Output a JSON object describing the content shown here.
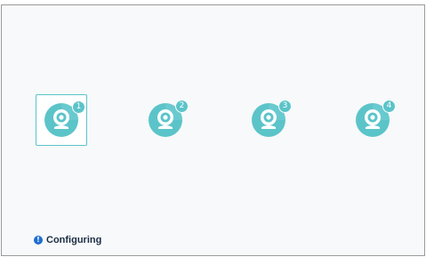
{
  "cameras": [
    {
      "number": "1",
      "selected": true
    },
    {
      "number": "2",
      "selected": false
    },
    {
      "number": "3",
      "selected": false
    },
    {
      "number": "4",
      "selected": false
    }
  ],
  "status": {
    "text": "Configuring",
    "icon": "info-icon",
    "icon_glyph": "!"
  },
  "colors": {
    "accent": "#5bc4c9",
    "status_icon": "#1f6fd1",
    "status_text": "#1c2d44"
  }
}
